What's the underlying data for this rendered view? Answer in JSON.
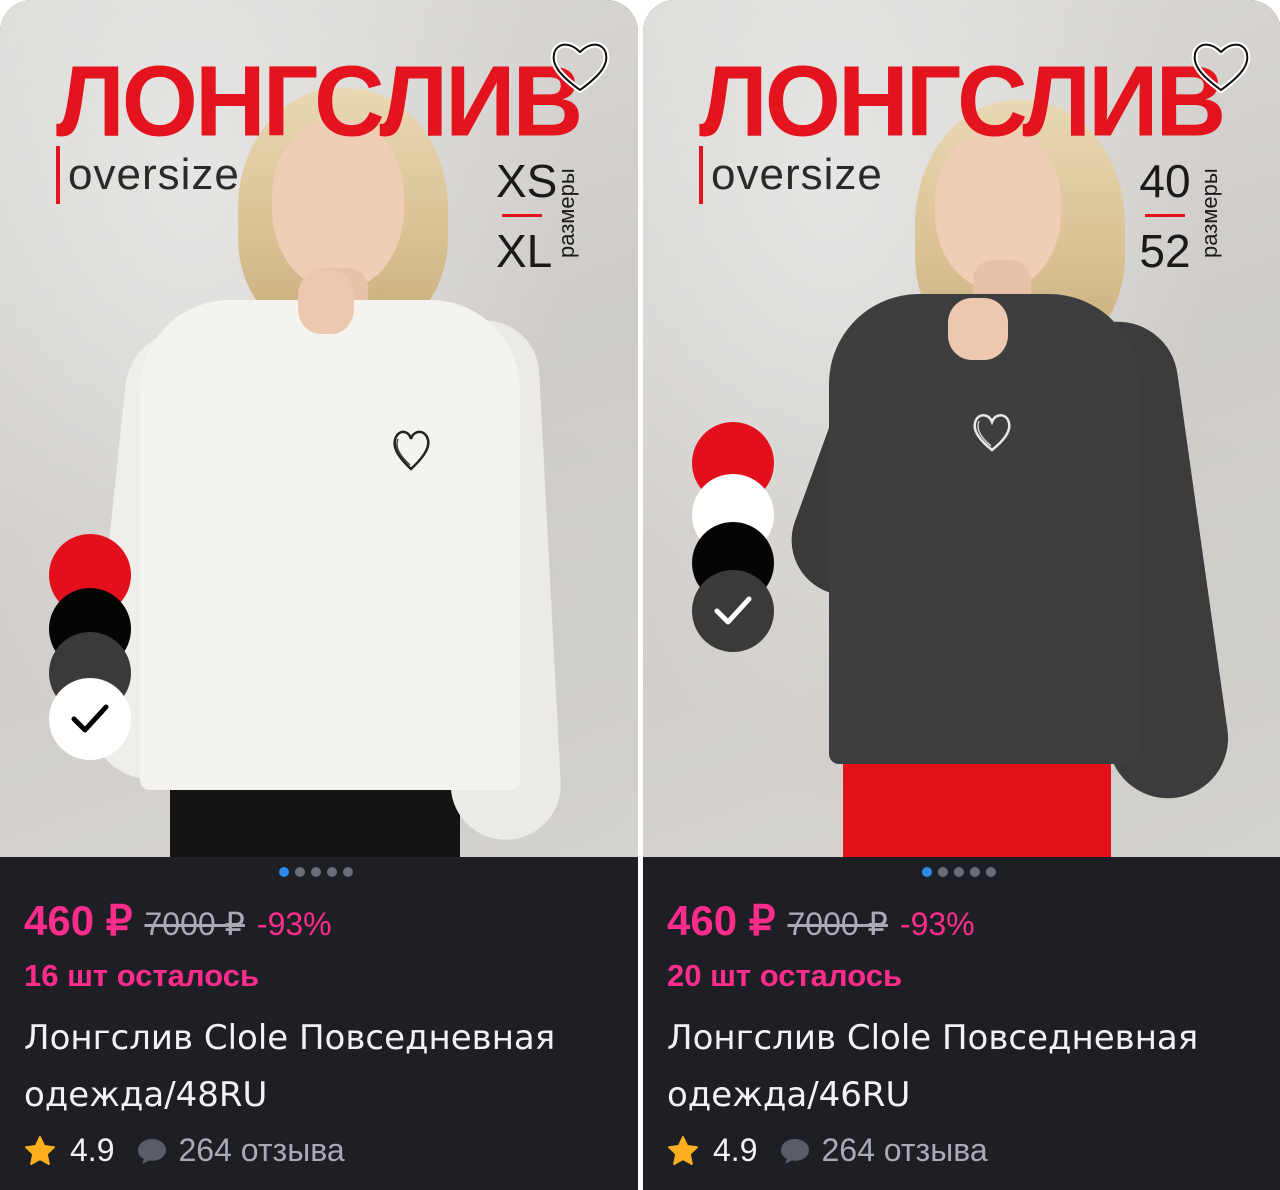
{
  "products": [
    {
      "banner": {
        "title": "ЛОНГСЛИВ",
        "fit": "oversize",
        "size_from": "XS",
        "size_to": "XL",
        "size_word": "размеры"
      },
      "swatches": [
        {
          "color": "#e3101c",
          "selected": false
        },
        {
          "color": "#050505",
          "selected": false
        },
        {
          "color": "#3a3a3b",
          "selected": false
        },
        {
          "color": "#ffffff",
          "selected": true
        }
      ],
      "shirt_color": "#f4f3ef",
      "price": "460 ₽",
      "old_price": "7000 ₽",
      "discount": "-93%",
      "stock": "16 шт осталось",
      "title": "Лонгслив Clole Повседневная одежда/48RU",
      "rating": "4.9",
      "reviews": "264 отзыва",
      "gallery": {
        "count": 5,
        "active": 1
      }
    },
    {
      "banner": {
        "title": "ЛОНГСЛИВ",
        "fit": "oversize",
        "size_from": "40",
        "size_to": "52",
        "size_word": "размеры"
      },
      "swatches": [
        {
          "color": "#e3101c",
          "selected": false
        },
        {
          "color": "#ffffff",
          "selected": false
        },
        {
          "color": "#050505",
          "selected": false
        },
        {
          "color": "#3a3a3b",
          "selected": true
        }
      ],
      "shirt_color": "#3d3e40",
      "price": "460 ₽",
      "old_price": "7000 ₽",
      "discount": "-93%",
      "stock": "20 шт осталось",
      "title": "Лонгслив Clole Повседневная одежда/46RU",
      "rating": "4.9",
      "reviews": "264 отзыва",
      "gallery": {
        "count": 5,
        "active": 1
      }
    }
  ],
  "icons": {
    "favorite": "heart-outline-icon",
    "rating": "star-icon",
    "reviews": "comment-bubble-icon",
    "selected": "checkmark-icon"
  },
  "colors": {
    "accent": "#ff2c8c",
    "brand_red": "#e3141e",
    "card_bg": "#1e1f25"
  }
}
